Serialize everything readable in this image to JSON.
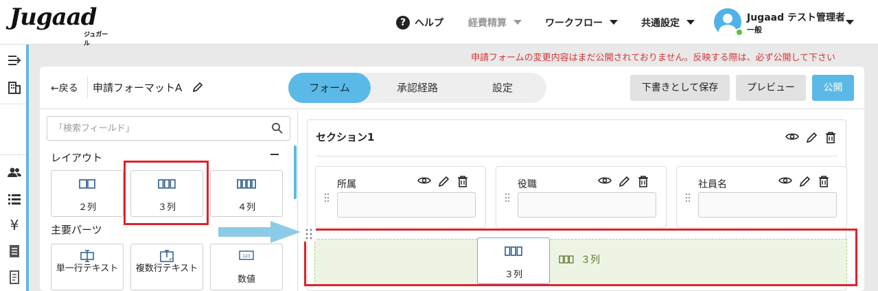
{
  "header": {
    "logo_text": "Jugaad",
    "logo_sub": "ジュガール",
    "help_label": "ヘルプ",
    "nav_expense": "経費精算",
    "nav_workflow": "ワークフロー",
    "nav_settings": "共通設定",
    "user_name": "Jugaad テスト管理者",
    "user_role": "一般"
  },
  "warning": "申請フォームの変更内容はまだ公開されておりません。反映する際は、必ず公開して下さい",
  "toolbar": {
    "back_label": "←戻る",
    "form_name": "申請フォーマットA",
    "tabs": [
      {
        "label": "フォーム",
        "active": true
      },
      {
        "label": "承認経路",
        "active": false
      },
      {
        "label": "設定",
        "active": false
      }
    ],
    "save_draft_label": "下書きとして保存",
    "preview_label": "プレビュー",
    "publish_label": "公開"
  },
  "left_panel": {
    "search_placeholder": "「検索フィールド」",
    "layout_title": "レイアウト",
    "layout_items": [
      {
        "label": "２列",
        "icon": "two-column-icon"
      },
      {
        "label": "３列",
        "icon": "three-column-icon"
      },
      {
        "label": "４列",
        "icon": "four-column-icon"
      }
    ],
    "parts_title": "主要パーツ",
    "parts_items": [
      {
        "label": "単一行テキスト",
        "icon": "single-line-text-icon"
      },
      {
        "label": "複数行テキスト",
        "icon": "multi-line-text-icon"
      },
      {
        "label": "数値",
        "icon": "number-icon"
      }
    ]
  },
  "right_panel": {
    "section_title": "セクション1",
    "fields": [
      {
        "label": "所属"
      },
      {
        "label": "役職"
      },
      {
        "label": "社員名"
      }
    ],
    "drag_ghost_label": "３列",
    "drop_label": "３列"
  },
  "colors": {
    "accent": "#5ab9e6",
    "highlight": "#e0212a",
    "warning": "#d43535",
    "drop_zone": "#eef4e3"
  }
}
